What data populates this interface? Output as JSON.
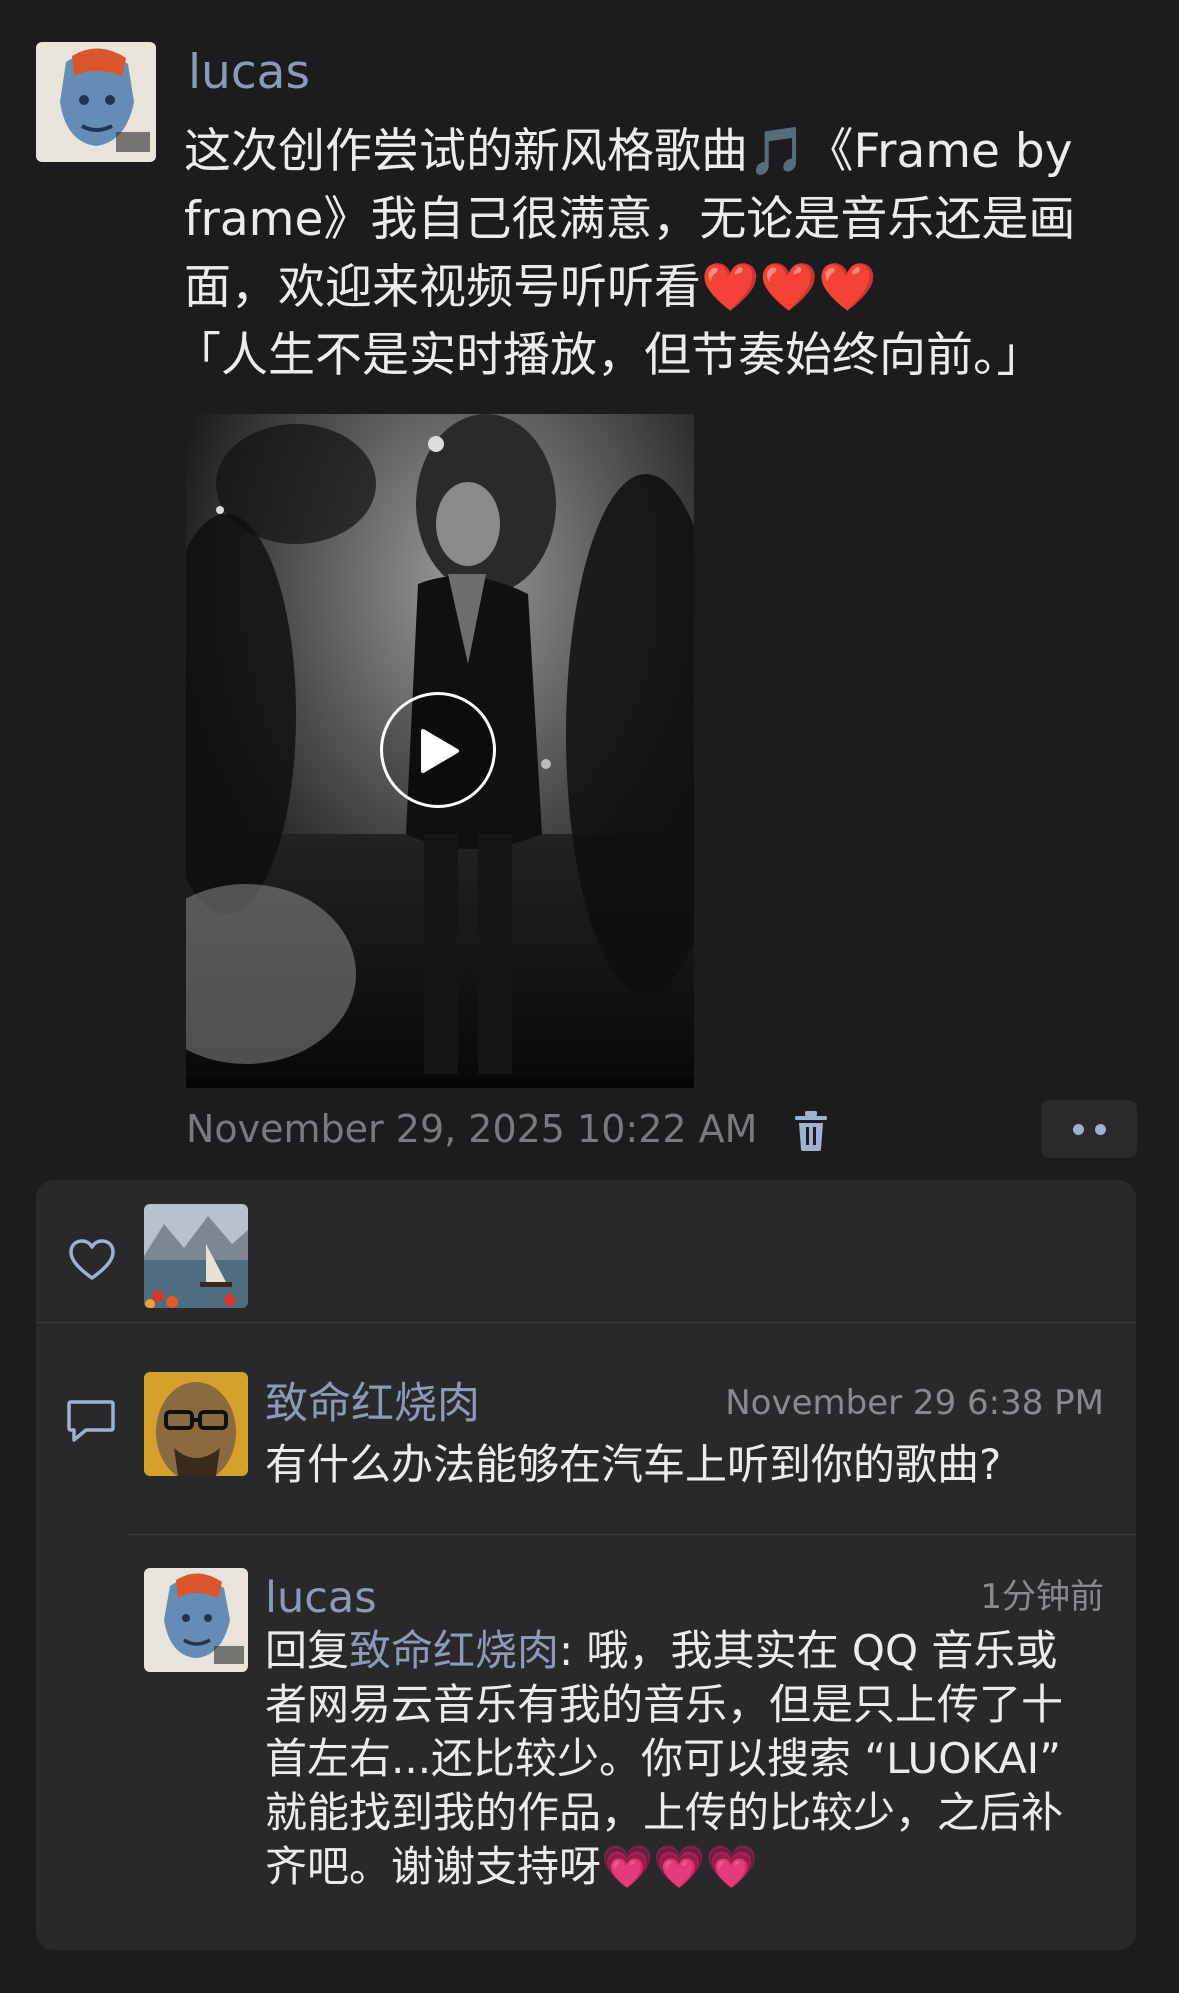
{
  "post": {
    "author": "lucas",
    "text_lines": [
      "这次创作尝试的新风格歌曲🎵《Frame by",
      "frame》我自己很满意，无论是音乐还是画",
      "面，欢迎来视频号听听看❤️❤️❤️",
      "「人生不是实时播放，但节奏始终向前。」"
    ],
    "timestamp": "November 29, 2025 10:22 AM"
  },
  "comments": [
    {
      "author": "致命红烧肉",
      "time": "November 29 6:38 PM",
      "text": "有什么办法能够在汽车上听到你的歌曲?"
    },
    {
      "author": "lucas",
      "time": "1分钟前",
      "reply_prefix": "回复",
      "reply_to": "致命红烧肉",
      "reply_colon": ": ",
      "text_lines": [
        "哦，我其实在 QQ 音乐或",
        "者网易云音乐有我的音乐，但是只上传了十",
        "首左右...还比较少。你可以搜索 “LUOKAI”",
        "就能找到我的作品，上传的比较少，之后补",
        "齐吧。谢谢支持呀"
      ],
      "trailing_emoji": "💗💗💗"
    }
  ],
  "icons": {
    "play": "play-icon",
    "delete": "trash-icon",
    "more": "more-dots-icon",
    "like": "heart-outline-icon",
    "comment": "comment-bubble-icon"
  },
  "colors": {
    "background": "#1c1c1e",
    "panel": "#29292c",
    "name_link": "#8c9ab8",
    "timestamp": "#7a7a7e"
  }
}
